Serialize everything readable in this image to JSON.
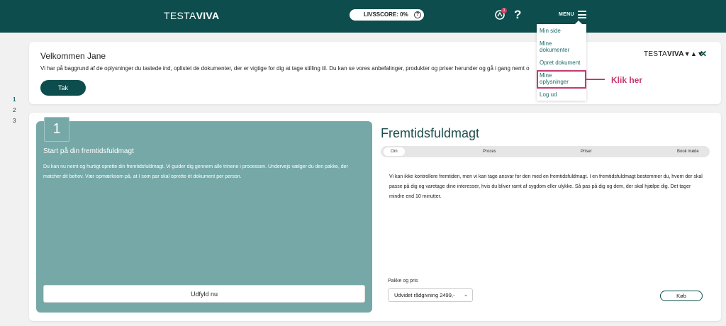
{
  "header": {
    "logo_light": "TESTA",
    "logo_bold": "VIVA",
    "score_label": "LIVSSCORE: 0%",
    "help_symbol": "?",
    "notification_count": "1",
    "menu_label": "MENU",
    "icons": [
      "question-circle-icon",
      "notification-icon",
      "help-icon",
      "hamburger-icon"
    ]
  },
  "dropdown": {
    "items": [
      {
        "label": "Min side"
      },
      {
        "label": "Mine dokumenter"
      },
      {
        "label": "Opret dokument"
      },
      {
        "label": "Mine oplysninger"
      },
      {
        "label": "Log ud"
      }
    ]
  },
  "callout": {
    "text": "Klik her",
    "color": "#c43a6e"
  },
  "welcome": {
    "title": "Velkommen Jane",
    "body": "Vi har på baggrund af de oplysninger du tastede ind, oplistet de dokumenter, der er vigtige for dig at tage stilling til. Du kan se vores anbefalinger, produkter og priser herunder og gå i gang nemt o",
    "button": "Tak",
    "brand_light": "TESTA",
    "brand_bold": "VIVA",
    "close_symbol": "✕"
  },
  "steps": [
    "1",
    "2",
    "3"
  ],
  "panel": {
    "number": "1",
    "title": "Start på din fremtidsfuldmagt",
    "text": "Du kan nu nemt og hurtigt oprette din fremtidsfuldmagt. Vi guider dig gennem alle trinene i processen. Undervejs vælger du den pakke, der matcher dit behov. Vær opmærksom på, at I som par skal oprette ét dokument per person.",
    "button": "Udfyld nu"
  },
  "product": {
    "title": "Fremtidsfuldmagt",
    "tabs": [
      "Om",
      "Proces",
      "Priser",
      "Book møde"
    ],
    "active_tab": "Om",
    "description": "Vi kan ikke kontrollere fremtiden, men vi kan tage ansvar for den med en fremtidsfuldmagt. I en fremtidsfuldmagt bestemmer du, hvem der skal passe på dig og varetage dine interesser, hvis du bliver ramt af sygdom eller ulykke. Så pas på dig og dem, der skal hjælpe dig. Det tager mindre end 10 minutter.",
    "package_label": "Pakke og pris",
    "package_selected": "Udvidet rådgivning 2499,-",
    "buy_button": "Køb"
  },
  "colors": {
    "brand_dark": "#0d4d4d",
    "panel_teal": "#76a8a8",
    "highlight": "#c43a6e"
  }
}
